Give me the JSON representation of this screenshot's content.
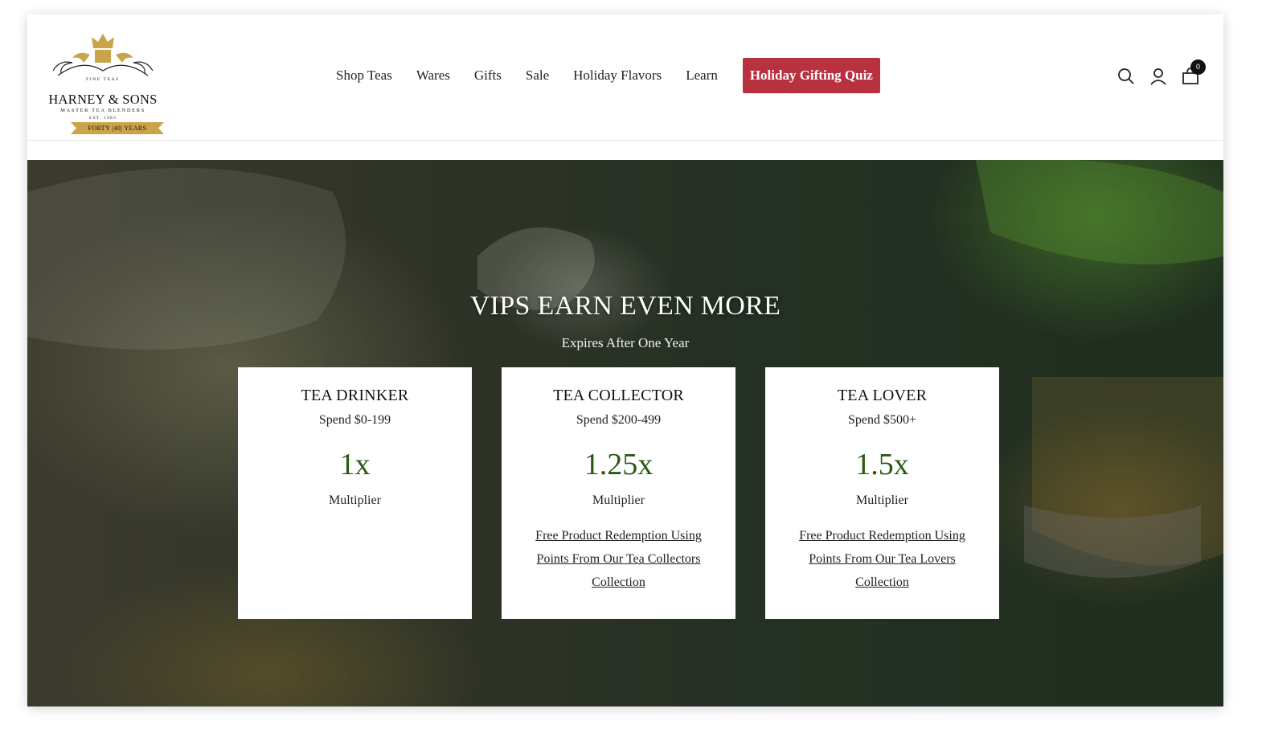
{
  "header": {
    "logo": {
      "top_text": "FINE TEAS",
      "brand": "HARNEY & SONS",
      "tagline": "MASTER TEA BLENDERS",
      "est": "EST. 1983",
      "banner": "FORTY |40| YEARS"
    },
    "nav": [
      {
        "label": "Shop Teas"
      },
      {
        "label": "Wares"
      },
      {
        "label": "Gifts"
      },
      {
        "label": "Sale"
      },
      {
        "label": "Holiday Flavors"
      },
      {
        "label": "Learn"
      }
    ],
    "quiz_button": "Holiday Gifting Quiz",
    "icons": [
      "search-icon",
      "account-icon",
      "cart-icon"
    ],
    "cart_count": "0"
  },
  "hero": {
    "title": "VIPS EARN EVEN MORE",
    "subtitle": "Expires After One Year",
    "tiers": [
      {
        "name": "TEA DRINKER",
        "spend": "Spend $0-199",
        "multiplier": "1x",
        "multiplier_label": "Multiplier",
        "perk": ""
      },
      {
        "name": "TEA COLLECTOR",
        "spend": "Spend $200-499",
        "multiplier": "1.25x",
        "multiplier_label": "Multiplier",
        "perk": "Free Product Redemption Using Points From Our Tea Collectors Collection"
      },
      {
        "name": "TEA LOVER",
        "spend": "Spend $500+",
        "multiplier": "1.5x",
        "multiplier_label": "Multiplier",
        "perk": "Free Product Redemption Using Points From Our Tea Lovers Collection"
      }
    ]
  },
  "colors": {
    "quiz_button": "#b8313f",
    "multiplier": "#2a5a12",
    "logo_gold": "#c9a44a"
  }
}
